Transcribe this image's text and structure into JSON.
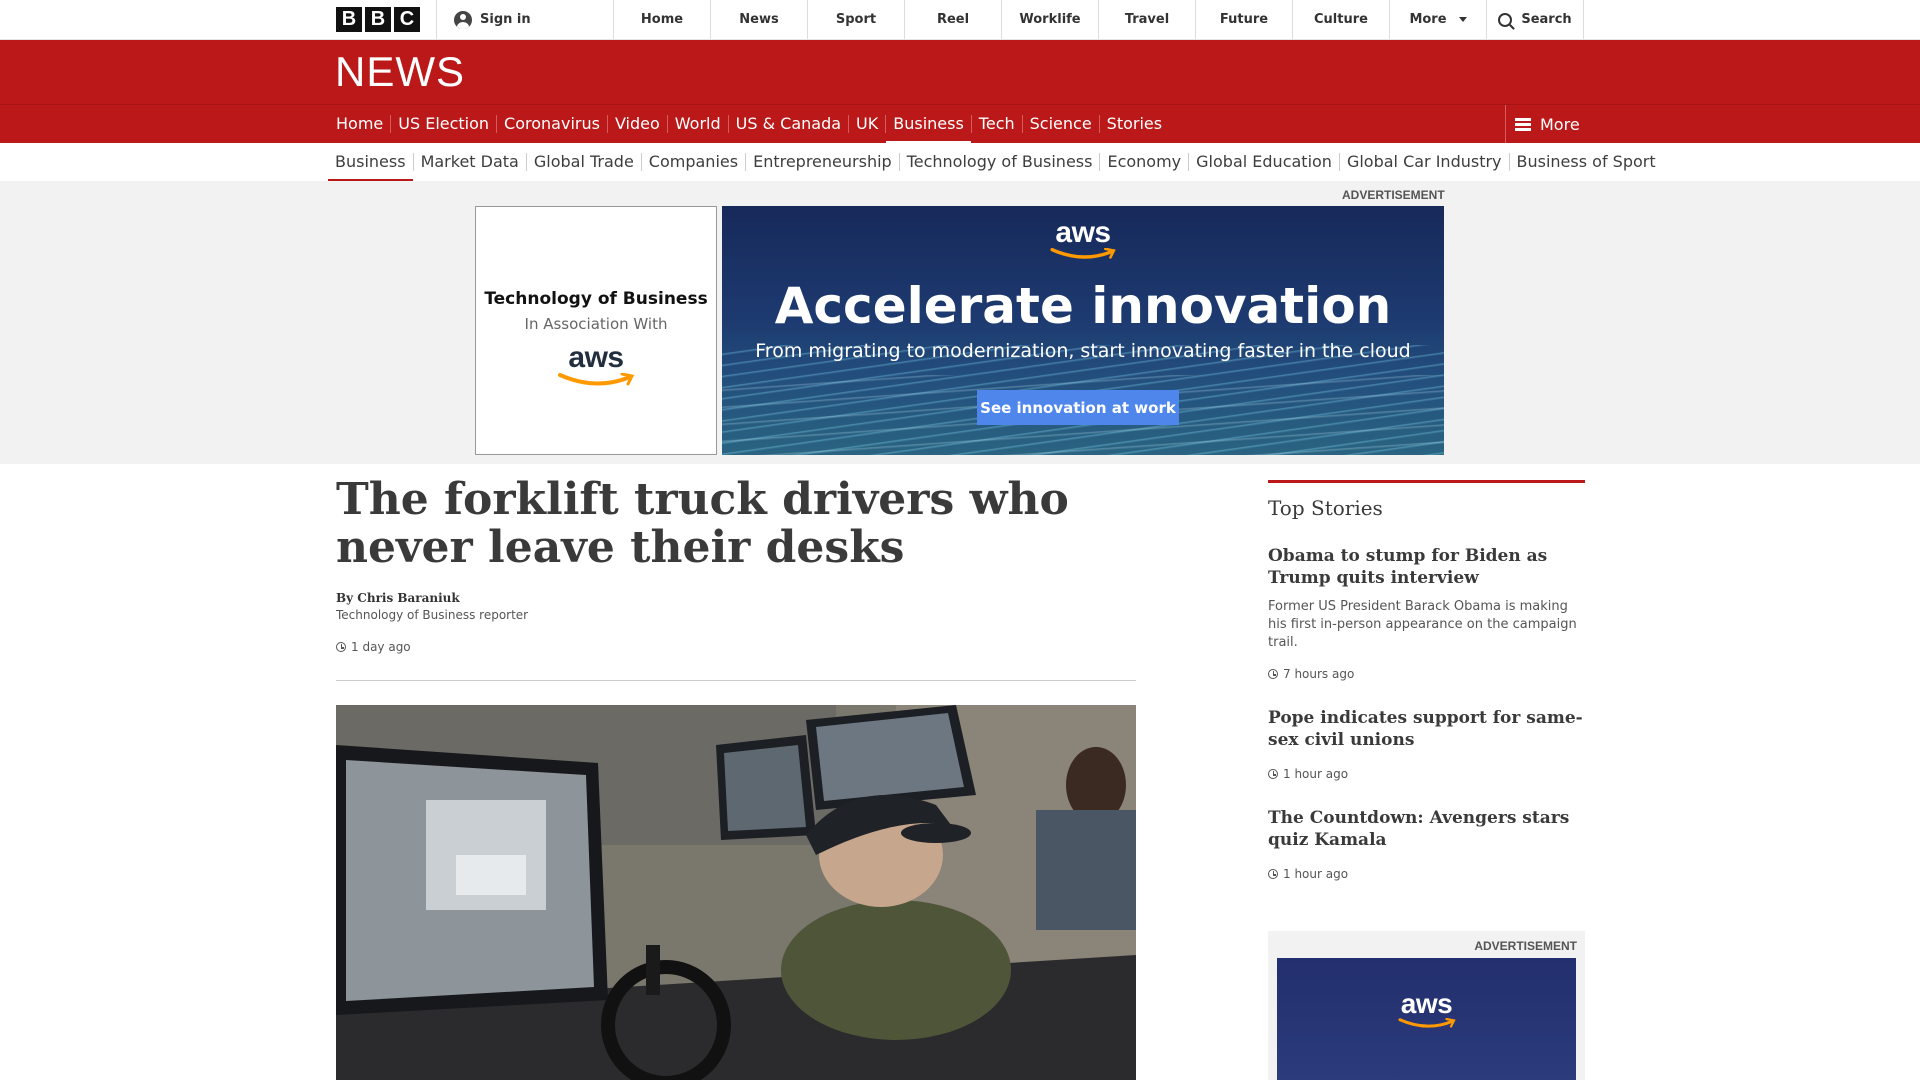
{
  "topbar": {
    "logo_letters": [
      "B",
      "B",
      "C"
    ],
    "sign_in": "Sign in",
    "nav": [
      "Home",
      "News",
      "Sport",
      "Reel",
      "Worklife",
      "Travel",
      "Future",
      "Culture",
      "More"
    ],
    "search": "Search"
  },
  "banner": {
    "title": "NEWS"
  },
  "section_nav": {
    "items": [
      "Home",
      "US Election",
      "Coronavirus",
      "Video",
      "World",
      "US & Canada",
      "UK",
      "Business",
      "Tech",
      "Science",
      "Stories"
    ],
    "active": "Business",
    "more": "More"
  },
  "sub_nav": {
    "items": [
      "Business",
      "Market Data",
      "Global Trade",
      "Companies",
      "Entrepreneurship",
      "Technology of Business",
      "Economy",
      "Global Education",
      "Global Car Industry",
      "Business of Sport"
    ],
    "active": "Business"
  },
  "ad": {
    "label": "ADVERTISEMENT",
    "sponsor_heading": "Technology of Business",
    "sponsor_sub": "In Association With",
    "brand": "aws",
    "headline": "Accelerate innovation",
    "tagline": "From migrating to modernization, start innovating faster in the cloud",
    "cta": "See innovation at work"
  },
  "article": {
    "headline": "The forklift truck drivers who never leave their desks",
    "byline": "By Chris Baraniuk",
    "role": "Technology of Business reporter",
    "timestamp": "1 day ago"
  },
  "top_stories": {
    "title": "Top Stories",
    "stories": [
      {
        "headline": "Obama to stump for Biden as Trump quits interview",
        "summary": "Former US President Barack Obama is making his first in-person appearance on the campaign trail.",
        "time": "7 hours ago"
      },
      {
        "headline": "Pope indicates support for same-sex civil unions",
        "time": "1 hour ago"
      },
      {
        "headline": "The Countdown: Avengers stars quiz Kamala",
        "time": "1 hour ago"
      }
    ]
  },
  "right_ad": {
    "label": "ADVERTISEMENT",
    "brand": "aws"
  },
  "colors": {
    "bbc_red": "#bb1919",
    "aws_orange": "#ff9900",
    "cta_blue": "#4f86ec"
  }
}
